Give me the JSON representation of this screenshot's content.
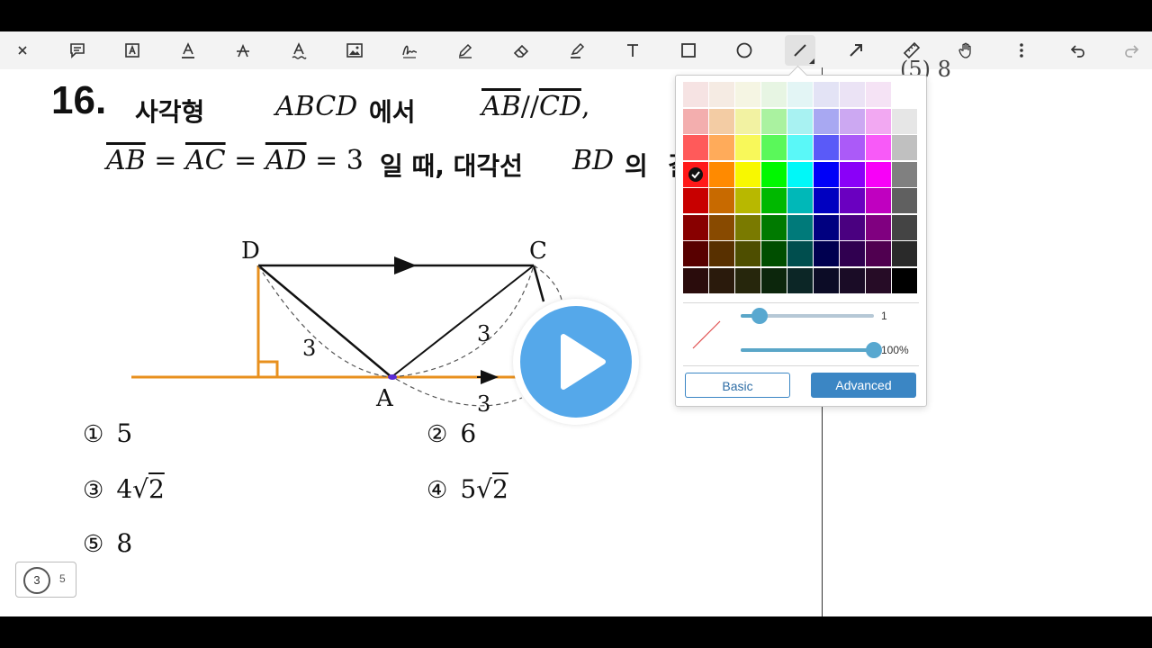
{
  "toolbar": {
    "tools": [
      {
        "id": "close",
        "icon": "close-icon"
      },
      {
        "id": "comment",
        "icon": "comment-icon"
      },
      {
        "id": "text-box",
        "icon": "text-box-icon"
      },
      {
        "id": "underline",
        "icon": "underline-icon"
      },
      {
        "id": "strikethrough",
        "icon": "strikethrough-icon"
      },
      {
        "id": "squiggly",
        "icon": "squiggly-icon"
      },
      {
        "id": "image",
        "icon": "image-icon"
      },
      {
        "id": "signature",
        "icon": "signature-icon"
      },
      {
        "id": "pen",
        "icon": "pen-icon"
      },
      {
        "id": "eraser",
        "icon": "eraser-icon"
      },
      {
        "id": "highlighter",
        "icon": "highlighter-icon"
      },
      {
        "id": "text",
        "icon": "text-icon"
      },
      {
        "id": "rectangle",
        "icon": "rectangle-icon"
      },
      {
        "id": "ellipse",
        "icon": "ellipse-icon"
      },
      {
        "id": "line",
        "icon": "line-icon",
        "active": true
      },
      {
        "id": "arrow",
        "icon": "arrow-icon"
      },
      {
        "id": "ruler",
        "icon": "ruler-icon"
      },
      {
        "id": "pan",
        "icon": "hand-icon"
      },
      {
        "id": "more",
        "icon": "more-vertical-icon"
      },
      {
        "id": "undo",
        "icon": "undo-icon"
      },
      {
        "id": "redo",
        "icon": "redo-icon"
      }
    ]
  },
  "question": {
    "number": "16.",
    "k1": "사각형",
    "m1": "ABCD",
    "k2": "에서",
    "m2a": "AB",
    "m2b": "//",
    "m2c": "CD",
    "m2d": ",",
    "m3a": "AB",
    "m3eq": "=",
    "m3b": "AC",
    "m3c": "AD",
    "m3d": "3",
    "k3": "일  때,  대각선",
    "m4": "BD",
    "k4": "의",
    "k4b": "길"
  },
  "diagram": {
    "label_d": "D",
    "label_c": "C",
    "label_a": "A",
    "label_3_left": "3",
    "label_3_mid": "3",
    "label_3_bottom": "3",
    "line_color": "#e8901e"
  },
  "choices": [
    {
      "mark": "①",
      "value": "5"
    },
    {
      "mark": "②",
      "value": "6"
    },
    {
      "mark": "③",
      "coef": "4",
      "radicand": "2"
    },
    {
      "mark": "④",
      "coef": "5",
      "radicand": "2"
    },
    {
      "mark": "⑤",
      "value": "8"
    }
  ],
  "right_column": {
    "partial_text": "(5)  8"
  },
  "page_badge": {
    "current": "3",
    "total": "5"
  },
  "palette": {
    "colors": [
      [
        "#f6e3e3",
        "#f5ebe3",
        "#f5f5e3",
        "#e7f5e3",
        "#e3f5f5",
        "#e3e3f5",
        "#ebe3f5",
        "#f5e3f5",
        "#ffffff"
      ],
      [
        "#f3aeae",
        "#f3cca4",
        "#f2f2a2",
        "#aaf2a0",
        "#a8f2f2",
        "#a8a8f2",
        "#cca8f2",
        "#f2a8f2",
        "#e6e6e6"
      ],
      [
        "#ff5a5a",
        "#ffab5a",
        "#f8f85a",
        "#5af85a",
        "#5af8f8",
        "#5a5af8",
        "#ab5af8",
        "#f85af8",
        "#c0c0c0"
      ],
      [
        "#ff1a1a",
        "#ff8a00",
        "#f8f800",
        "#00f800",
        "#00f8f8",
        "#0000f8",
        "#8a00f8",
        "#f800f8",
        "#808080"
      ],
      [
        "#c80000",
        "#c86a00",
        "#b8b800",
        "#00b800",
        "#00b8b8",
        "#0000c0",
        "#6a00c0",
        "#c000c0",
        "#606060"
      ],
      [
        "#880000",
        "#884a00",
        "#7a7a00",
        "#007a00",
        "#007a7a",
        "#000080",
        "#4a0080",
        "#800080",
        "#444444"
      ],
      [
        "#580000",
        "#583000",
        "#4e4e00",
        "#004e00",
        "#004e4e",
        "#000050",
        "#300050",
        "#500050",
        "#2a2a2a"
      ],
      [
        "#2a0c0c",
        "#2a1a0c",
        "#26260c",
        "#0c260c",
        "#0c2626",
        "#0c0c26",
        "#1a0c26",
        "#260c26",
        "#000000"
      ]
    ],
    "selected": [
      3,
      0
    ],
    "thickness": {
      "value": 1,
      "label": "1"
    },
    "opacity": {
      "value": 100,
      "label": "100%"
    },
    "preview_color": "#e05050",
    "basic_label": "Basic",
    "advanced_label": "Advanced"
  },
  "play_button": {
    "icon": "play-icon"
  }
}
